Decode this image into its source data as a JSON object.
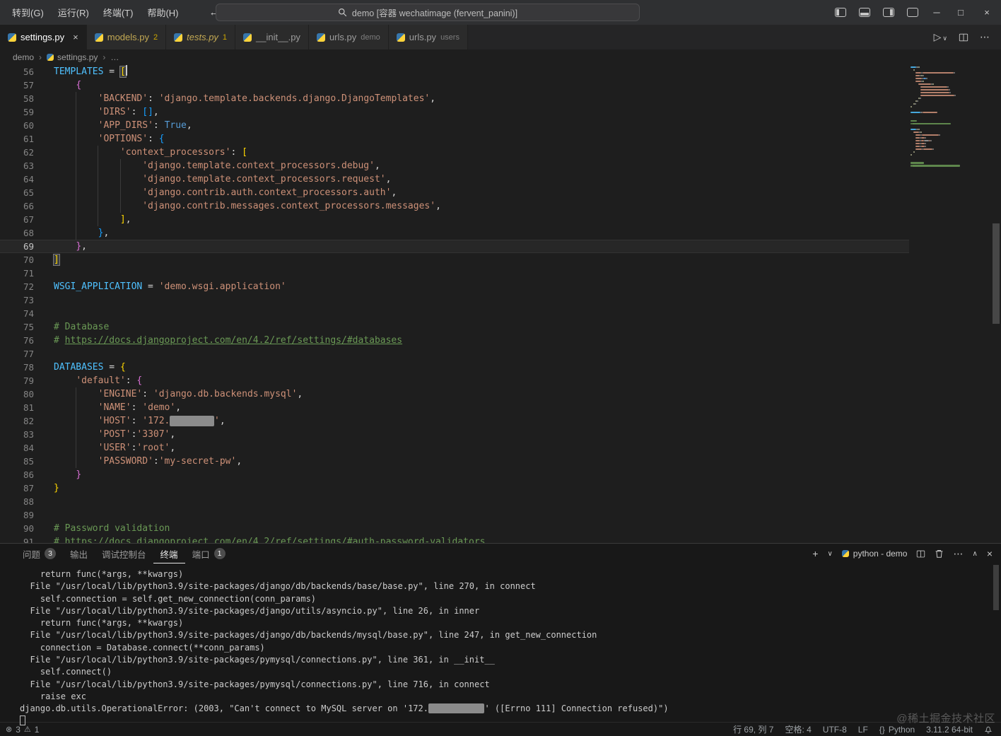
{
  "titlebar": {
    "menus": [
      "转到(G)",
      "运行(R)",
      "终端(T)",
      "帮助(H)"
    ],
    "search_text": "demo [容器 wechatimage (fervent_panini)]"
  },
  "icons": {
    "back": "←",
    "forward": "→",
    "run": "▷",
    "chevron_down": "∨",
    "chevron_up": "∧",
    "chevron_right": "›",
    "more": "⋯",
    "close": "×",
    "minimize": "─",
    "maximize": "□",
    "plus": "+",
    "error": "⊗",
    "warning": "⚠",
    "braces": "{}"
  },
  "editor_tabs": [
    {
      "name": "settings.py",
      "active": true
    },
    {
      "name": "models.py",
      "badge": "2",
      "problem": true
    },
    {
      "name": "tests.py",
      "badge": "1",
      "italic": true,
      "problem": true
    },
    {
      "name": "__init__.py"
    },
    {
      "name": "urls.py",
      "hint": "demo"
    },
    {
      "name": "urls.py",
      "hint": "users"
    }
  ],
  "breadcrumb": {
    "items": [
      {
        "label": "demo"
      },
      {
        "label": "settings.py",
        "icon": true
      },
      {
        "label": "…"
      }
    ]
  },
  "editor": {
    "lines": [
      {
        "n": 56,
        "t": [
          [
            "v",
            "TEMPLATES"
          ],
          [
            "o",
            " = "
          ],
          [
            "b1m",
            "["
          ],
          [
            "cur",
            ""
          ]
        ]
      },
      {
        "n": 57,
        "t": [
          [
            "w",
            "    "
          ],
          [
            "b2",
            "{"
          ]
        ]
      },
      {
        "n": 58,
        "t": [
          [
            "w",
            "        "
          ],
          [
            "s",
            "'BACKEND'"
          ],
          [
            "o",
            ": "
          ],
          [
            "s",
            "'django.template.backends.django.DjangoTemplates'"
          ],
          [
            "o",
            ","
          ]
        ]
      },
      {
        "n": 59,
        "t": [
          [
            "w",
            "        "
          ],
          [
            "s",
            "'DIRS'"
          ],
          [
            "o",
            ": "
          ],
          [
            "b3",
            "[]"
          ],
          [
            "o",
            ","
          ]
        ]
      },
      {
        "n": 60,
        "t": [
          [
            "w",
            "        "
          ],
          [
            "s",
            "'APP_DIRS'"
          ],
          [
            "o",
            ": "
          ],
          [
            "k",
            "True"
          ],
          [
            "o",
            ","
          ]
        ]
      },
      {
        "n": 61,
        "t": [
          [
            "w",
            "        "
          ],
          [
            "s",
            "'OPTIONS'"
          ],
          [
            "o",
            ": "
          ],
          [
            "b3",
            "{"
          ]
        ]
      },
      {
        "n": 62,
        "t": [
          [
            "w",
            "            "
          ],
          [
            "s",
            "'context_processors'"
          ],
          [
            "o",
            ": "
          ],
          [
            "b1",
            "["
          ]
        ]
      },
      {
        "n": 63,
        "t": [
          [
            "w",
            "                "
          ],
          [
            "s",
            "'django.template.context_processors.debug'"
          ],
          [
            "o",
            ","
          ]
        ]
      },
      {
        "n": 64,
        "t": [
          [
            "w",
            "                "
          ],
          [
            "s",
            "'django.template.context_processors.request'"
          ],
          [
            "o",
            ","
          ]
        ]
      },
      {
        "n": 65,
        "t": [
          [
            "w",
            "                "
          ],
          [
            "s",
            "'django.contrib.auth.context_processors.auth'"
          ],
          [
            "o",
            ","
          ]
        ]
      },
      {
        "n": 66,
        "t": [
          [
            "w",
            "                "
          ],
          [
            "s",
            "'django.contrib.messages.context_processors.messages'"
          ],
          [
            "o",
            ","
          ]
        ]
      },
      {
        "n": 67,
        "t": [
          [
            "w",
            "            "
          ],
          [
            "b1",
            "]"
          ],
          [
            "o",
            ","
          ]
        ]
      },
      {
        "n": 68,
        "t": [
          [
            "w",
            "        "
          ],
          [
            "b3",
            "}"
          ],
          [
            "o",
            ","
          ]
        ]
      },
      {
        "n": 69,
        "hl": true,
        "t": [
          [
            "w",
            "    "
          ],
          [
            "b2",
            "}"
          ],
          [
            "o",
            ","
          ]
        ]
      },
      {
        "n": 70,
        "t": [
          [
            "b1m",
            "]"
          ]
        ]
      },
      {
        "n": 71,
        "t": []
      },
      {
        "n": 72,
        "t": [
          [
            "v",
            "WSGI_APPLICATION"
          ],
          [
            "o",
            " = "
          ],
          [
            "s",
            "'demo.wsgi.application'"
          ]
        ]
      },
      {
        "n": 73,
        "t": []
      },
      {
        "n": 74,
        "t": []
      },
      {
        "n": 75,
        "t": [
          [
            "c",
            "# Database"
          ]
        ]
      },
      {
        "n": 76,
        "t": [
          [
            "c",
            "# "
          ],
          [
            "lk",
            "https://docs.djangoproject.com/en/4.2/ref/settings/#databases"
          ]
        ]
      },
      {
        "n": 77,
        "t": []
      },
      {
        "n": 78,
        "t": [
          [
            "v",
            "DATABASES"
          ],
          [
            "o",
            " = "
          ],
          [
            "b1",
            "{"
          ]
        ]
      },
      {
        "n": 79,
        "t": [
          [
            "w",
            "    "
          ],
          [
            "s",
            "'default'"
          ],
          [
            "o",
            ": "
          ],
          [
            "b2",
            "{"
          ]
        ]
      },
      {
        "n": 80,
        "t": [
          [
            "w",
            "        "
          ],
          [
            "s",
            "'ENGINE'"
          ],
          [
            "o",
            ": "
          ],
          [
            "s",
            "'django.db.backends.mysql'"
          ],
          [
            "o",
            ","
          ]
        ]
      },
      {
        "n": 81,
        "t": [
          [
            "w",
            "        "
          ],
          [
            "s",
            "'NAME'"
          ],
          [
            "o",
            ": "
          ],
          [
            "s",
            "'demo'"
          ],
          [
            "o",
            ","
          ]
        ]
      },
      {
        "n": 82,
        "t": [
          [
            "w",
            "        "
          ],
          [
            "s",
            "'HOST'"
          ],
          [
            "o",
            ": "
          ],
          [
            "s",
            "'172."
          ],
          [
            "red",
            "        "
          ],
          [
            "s",
            "'"
          ],
          [
            "o",
            ","
          ]
        ]
      },
      {
        "n": 83,
        "t": [
          [
            "w",
            "        "
          ],
          [
            "s",
            "'POST'"
          ],
          [
            "o",
            ":"
          ],
          [
            "s",
            "'3307'"
          ],
          [
            "o",
            ","
          ]
        ]
      },
      {
        "n": 84,
        "t": [
          [
            "w",
            "        "
          ],
          [
            "s",
            "'USER'"
          ],
          [
            "o",
            ":"
          ],
          [
            "s",
            "'root'"
          ],
          [
            "o",
            ","
          ]
        ]
      },
      {
        "n": 85,
        "t": [
          [
            "w",
            "        "
          ],
          [
            "s",
            "'PASSWORD'"
          ],
          [
            "o",
            ":"
          ],
          [
            "s",
            "'my-secret-pw'"
          ],
          [
            "o",
            ","
          ]
        ]
      },
      {
        "n": 86,
        "t": [
          [
            "w",
            "    "
          ],
          [
            "b2",
            "}"
          ]
        ]
      },
      {
        "n": 87,
        "t": [
          [
            "b1",
            "}"
          ]
        ]
      },
      {
        "n": 88,
        "t": []
      },
      {
        "n": 89,
        "t": []
      },
      {
        "n": 90,
        "t": [
          [
            "c",
            "# Password validation"
          ]
        ]
      },
      {
        "n": 91,
        "t": [
          [
            "c",
            "# "
          ],
          [
            "lk",
            "https://docs.djangoproject.com/en/4.2/ref/settings/#auth-password-validators"
          ]
        ]
      }
    ]
  },
  "panel": {
    "tabs": [
      {
        "label": "问题",
        "badge": "3"
      },
      {
        "label": "输出"
      },
      {
        "label": "调试控制台"
      },
      {
        "label": "终端",
        "active": true
      },
      {
        "label": "端口",
        "badge": "1"
      }
    ],
    "toolbar": {
      "terminal_label": "python - demo"
    },
    "terminal": {
      "lines": [
        [
          [
            "t",
            "    return func(*args, **kwargs)"
          ]
        ],
        [
          [
            "t",
            "  File \"/usr/local/lib/python3.9/site-packages/django/db/backends/base/base.py\", line 270, in connect"
          ]
        ],
        [
          [
            "t",
            "    self.connection = self.get_new_connection(conn_params)"
          ]
        ],
        [
          [
            "t",
            "  File \"/usr/local/lib/python3.9/site-packages/django/utils/asyncio.py\", line 26, in inner"
          ]
        ],
        [
          [
            "t",
            "    return func(*args, **kwargs)"
          ]
        ],
        [
          [
            "t",
            "  File \"/usr/local/lib/python3.9/site-packages/django/db/backends/mysql/base.py\", line 247, in get_new_connection"
          ]
        ],
        [
          [
            "t",
            "    connection = Database.connect(**conn_params)"
          ]
        ],
        [
          [
            "t",
            "  File \"/usr/local/lib/python3.9/site-packages/pymysql/connections.py\", line 361, in __init__"
          ]
        ],
        [
          [
            "t",
            "    self.connect()"
          ]
        ],
        [
          [
            "t",
            "  File \"/usr/local/lib/python3.9/site-packages/pymysql/connections.py\", line 716, in connect"
          ]
        ],
        [
          [
            "t",
            "    raise exc"
          ]
        ],
        [
          [
            "t",
            "django.db.utils.OperationalError: (2003, \"Can't connect to MySQL server on '172."
          ],
          [
            "red",
            "           "
          ],
          [
            "t",
            "' ([Errno 111] Connection refused)\")"
          ]
        ],
        [
          [
            "cur",
            ""
          ]
        ]
      ]
    }
  },
  "statusbar": {
    "errors": "3",
    "warnings": "1",
    "cursor_position": "行 69, 列 7",
    "indentation": "空格: 4",
    "encoding": "UTF-8",
    "eol": "LF",
    "language": "Python",
    "interpreter": "3.11.2 64-bit"
  },
  "watermark": "@稀土掘金技术社区",
  "colors": {
    "accent": "#0078d4",
    "string": "#ce9178",
    "comment": "#6a9955",
    "constant": "#4fc1ff",
    "keyword": "#569cd6",
    "warning_badge": "#cca700",
    "bracket1": "#ffd700",
    "bracket2": "#da70d6",
    "bracket3": "#179fff"
  }
}
